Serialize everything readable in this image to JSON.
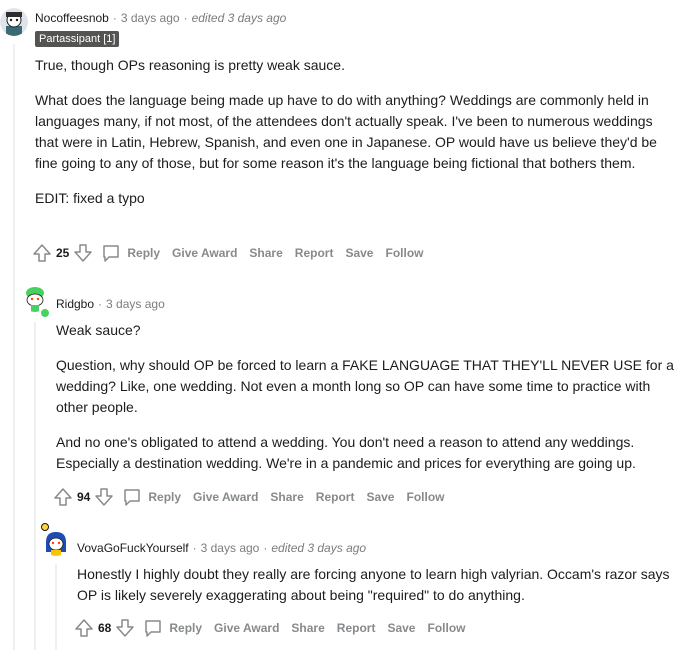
{
  "comments": [
    {
      "username": "Nocoffeesnob",
      "time": "3 days ago",
      "edited": "edited 3 days ago",
      "flair": "Partassipant [1]",
      "paragraphs": [
        "True, though OPs reasoning is pretty weak sauce.",
        "What does the language being made up have to do with anything? Weddings are commonly held in languages many, if not most, of the attendees don't actually speak. I've been to numerous weddings that were in Latin, Hebrew, Spanish, and even one in Japanese. OP would have us believe they'd be fine going to any of those, but for some reason it's the language being fictional that bothers them.",
        "EDIT: fixed a typo"
      ],
      "votes": "25"
    },
    {
      "username": "Ridgbo",
      "time": "3 days ago",
      "paragraphs": [
        "Weak sauce?",
        "Question, why should OP be forced to learn a FAKE LANGUAGE THAT THEY'LL NEVER USE for a wedding? Like, one wedding. Not even a month long so OP can have some time to practice with other people.",
        "And no one's obligated to attend a wedding. You don't need a reason to attend any weddings. Especially a destination wedding. We're in a pandemic and prices for everything are going up."
      ],
      "votes": "94"
    },
    {
      "username": "VovaGoFuckYourself",
      "time": "3 days ago",
      "edited": "edited 3 days ago",
      "paragraphs": [
        "Honestly I highly doubt they really are forcing anyone to learn high valyrian. Occam's razor says OP is likely severely exaggerating about being \"required\" to do anything."
      ],
      "votes": "68"
    }
  ],
  "actions": {
    "reply": "Reply",
    "give_award": "Give Award",
    "share": "Share",
    "report": "Report",
    "save": "Save",
    "follow": "Follow"
  },
  "separator": "·",
  "icons": {
    "upvote": "upvote-arrow-icon",
    "downvote": "downvote-arrow-icon",
    "reply": "speech-bubble-icon"
  },
  "colors": {
    "flair_bg": "#545452",
    "online_dot": "#46d160",
    "action_text": "#878a8c"
  }
}
